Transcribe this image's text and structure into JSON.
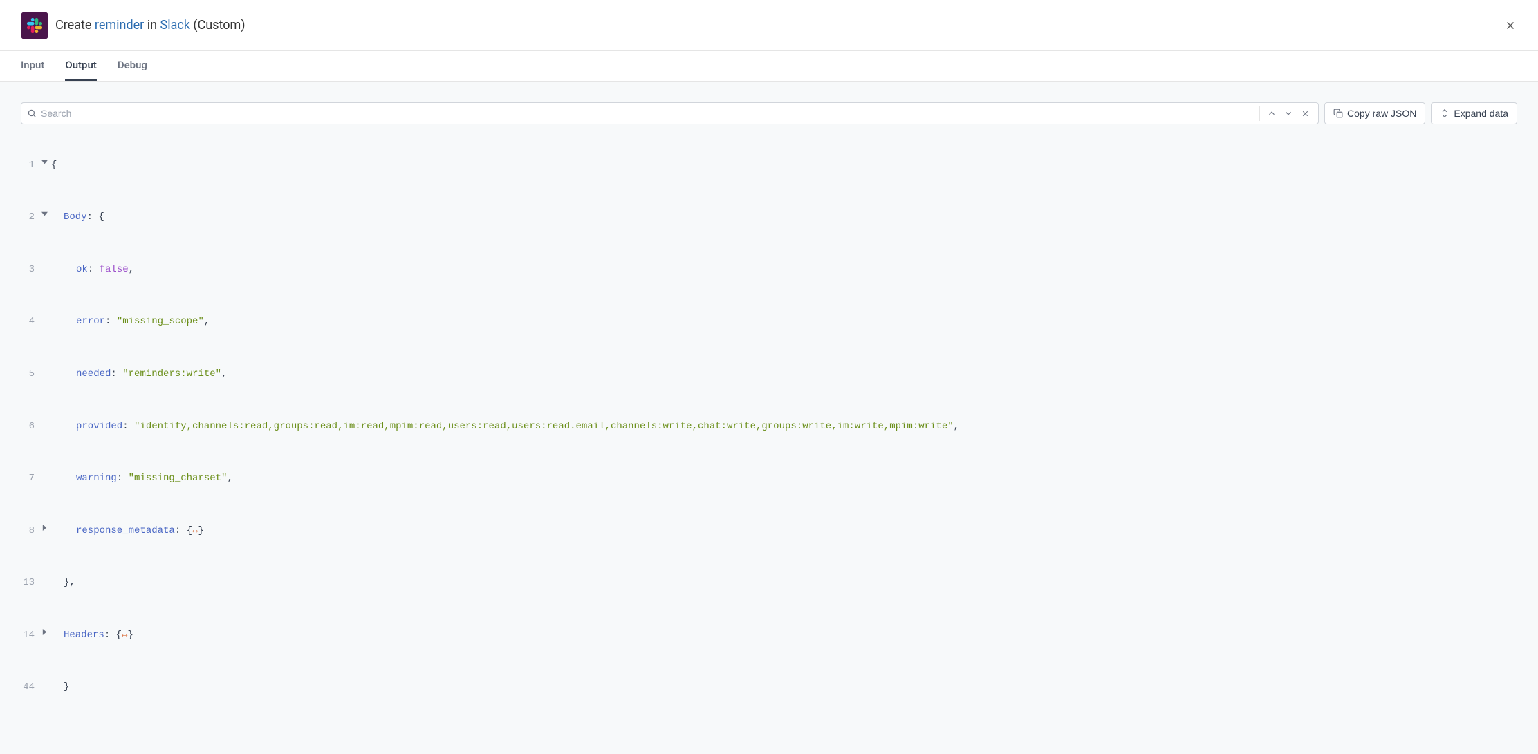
{
  "header": {
    "title_prefix": "Create ",
    "title_link1": "reminder",
    "title_mid": " in ",
    "title_link2": "Slack",
    "title_suffix": " (Custom)"
  },
  "tabs": {
    "input": "Input",
    "output": "Output",
    "debug": "Debug"
  },
  "search": {
    "placeholder": "Search"
  },
  "buttons": {
    "copy_raw": "Copy raw JSON",
    "expand_data": "Expand data"
  },
  "json_lines": {
    "l1_num": "1",
    "l1_code": "{",
    "l2_num": "2",
    "l2_key": "Body",
    "l2_after": ": {",
    "l3_num": "3",
    "l3_key": "ok",
    "l3_val": "false",
    "l4_num": "4",
    "l4_key": "error",
    "l4_val": "\"missing_scope\"",
    "l5_num": "5",
    "l5_key": "needed",
    "l5_val": "\"reminders:write\"",
    "l6_num": "6",
    "l6_key": "provided",
    "l6_val": "\"identify,channels:read,groups:read,im:read,mpim:read,users:read,users:read.email,channels:write,chat:write,groups:write,im:write,mpim:write\"",
    "l7_num": "7",
    "l7_key": "warning",
    "l7_val": "\"missing_charset\"",
    "l8_num": "8",
    "l8_key": "response_metadata",
    "l8_after_open": ": {",
    "l8_arrow": "↔",
    "l8_after_close": "}",
    "l13_num": "13",
    "l13_code": "},",
    "l14_num": "14",
    "l14_key": "Headers",
    "l14_after_open": ": {",
    "l14_arrow": "↔",
    "l14_after_close": "}",
    "l44_num": "44",
    "l44_code": "}"
  }
}
